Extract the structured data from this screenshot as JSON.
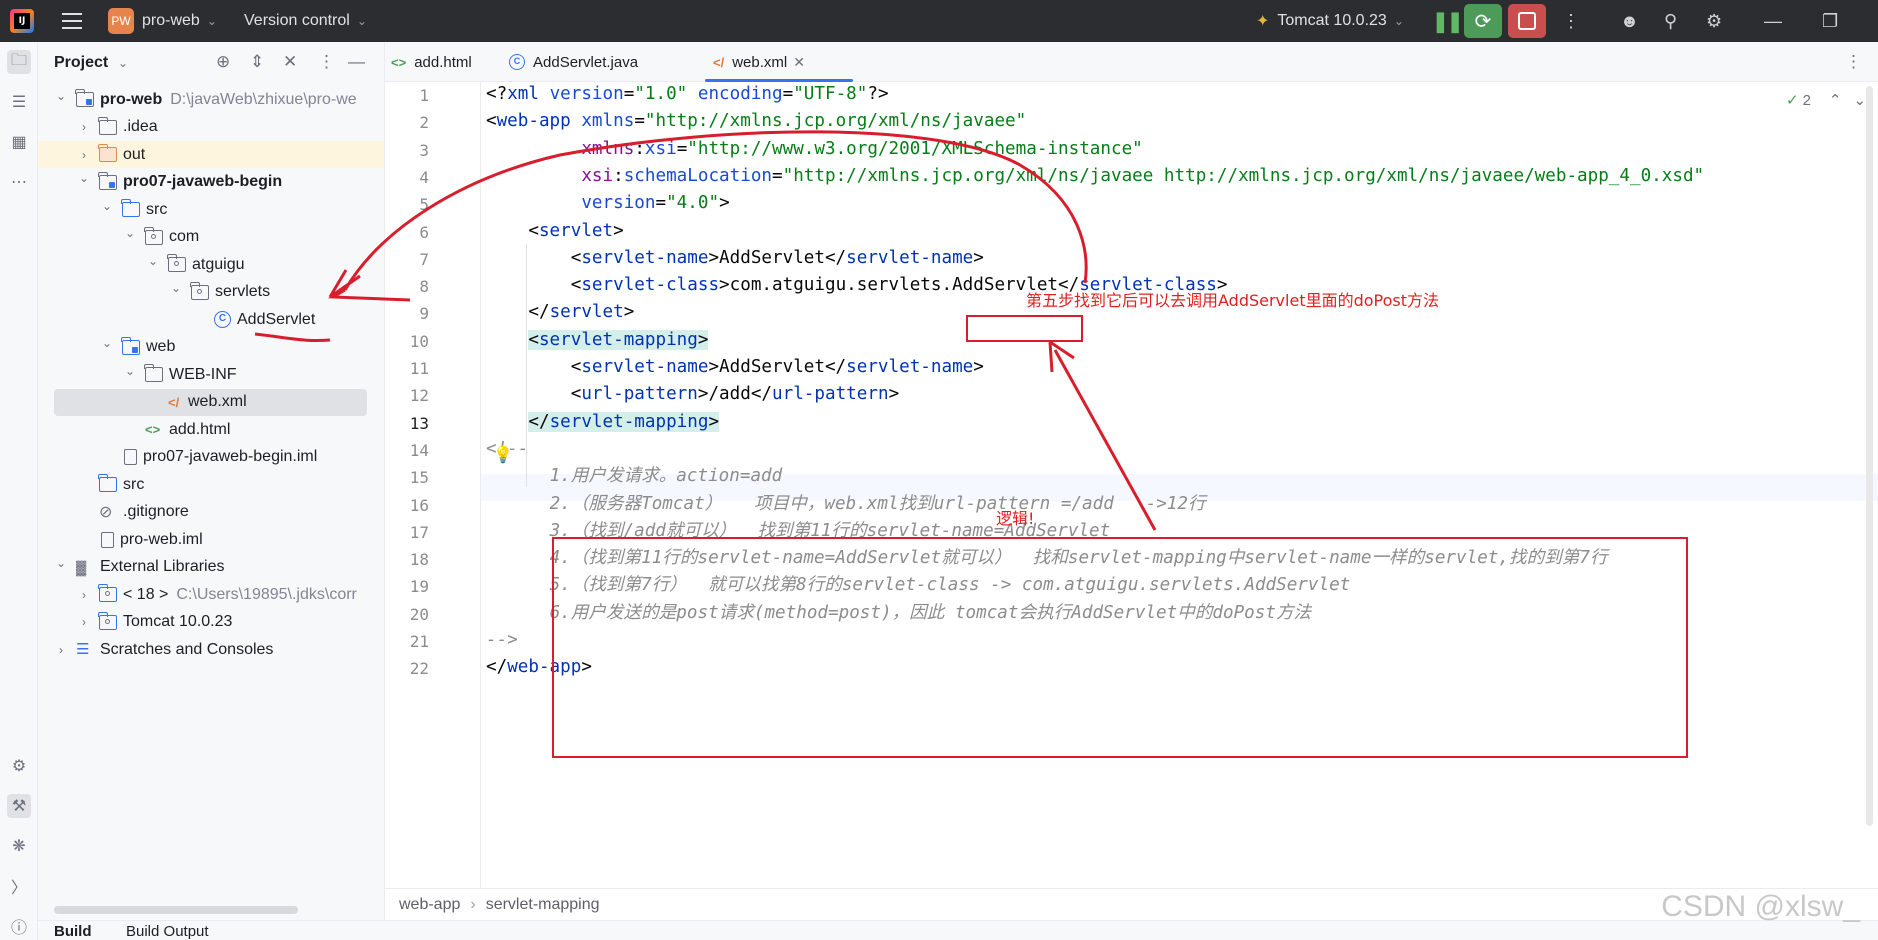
{
  "titlebar": {
    "project_badge": "PW",
    "project_name": "pro-web",
    "vcs": "Version control",
    "run_config": "Tomcat 10.0.23"
  },
  "project_panel": {
    "title": "Project",
    "tree": [
      {
        "label": "pro-web",
        "extra": "D:\\javaWeb\\zhixue\\pro-we",
        "depth": 0,
        "arrow": "open",
        "icon": "module-folder",
        "bold": true
      },
      {
        "label": ".idea",
        "depth": 1,
        "arrow": "closed",
        "icon": "folder"
      },
      {
        "label": "out",
        "depth": 1,
        "arrow": "closed",
        "icon": "folder-orange"
      },
      {
        "label": "pro07-javaweb-begin",
        "depth": 1,
        "arrow": "open",
        "icon": "module-folder",
        "bold": true
      },
      {
        "label": "src",
        "depth": 2,
        "arrow": "open",
        "icon": "folder-blue"
      },
      {
        "label": "com",
        "depth": 3,
        "arrow": "open",
        "icon": "package"
      },
      {
        "label": "atguigu",
        "depth": 4,
        "arrow": "open",
        "icon": "package"
      },
      {
        "label": "servlets",
        "depth": 5,
        "arrow": "open",
        "icon": "package"
      },
      {
        "label": "AddServlet",
        "depth": 6,
        "arrow": "none",
        "icon": "class"
      },
      {
        "label": "web",
        "depth": 2,
        "arrow": "open",
        "icon": "folder-web"
      },
      {
        "label": "WEB-INF",
        "depth": 3,
        "arrow": "open",
        "icon": "folder"
      },
      {
        "label": "web.xml",
        "depth": 4,
        "arrow": "none",
        "icon": "xml"
      },
      {
        "label": "add.html",
        "depth": 3,
        "arrow": "none",
        "icon": "html"
      },
      {
        "label": "pro07-javaweb-begin.iml",
        "depth": 2,
        "arrow": "none",
        "icon": "file"
      },
      {
        "label": "src",
        "depth": 1,
        "arrow": "none",
        "icon": "folder-blue"
      },
      {
        "label": ".gitignore",
        "depth": 1,
        "arrow": "none",
        "icon": "ignore"
      },
      {
        "label": "pro-web.iml",
        "depth": 1,
        "arrow": "none",
        "icon": "file"
      },
      {
        "label": "External Libraries",
        "depth": 0,
        "arrow": "open",
        "icon": "library"
      },
      {
        "label": "< 18 >",
        "extra": "C:\\Users\\19895\\.jdks\\corr",
        "depth": 1,
        "arrow": "closed",
        "icon": "jdk"
      },
      {
        "label": "Tomcat 10.0.23",
        "depth": 1,
        "arrow": "closed",
        "icon": "library-folder"
      },
      {
        "label": "Scratches and Consoles",
        "depth": 0,
        "arrow": "closed",
        "icon": "scratches"
      }
    ]
  },
  "tabs": [
    {
      "label": "add.html",
      "icon": "html-icon"
    },
    {
      "label": "AddServlet.java",
      "icon": "class-icon"
    },
    {
      "label": "web.xml",
      "icon": "xml-icon",
      "active": true
    }
  ],
  "editor": {
    "inspection_count": "2",
    "line_numbers": [
      "1",
      "2",
      "3",
      "4",
      "5",
      "6",
      "7",
      "8",
      "9",
      "10",
      "11",
      "12",
      "13",
      "14",
      "15",
      "16",
      "17",
      "18",
      "19",
      "20",
      "21",
      "22"
    ],
    "current_line": "13",
    "comment_lines": [
      "1.用户发请求。action=add",
      "2.（服务器Tomcat）   项目中，web.xml找到url-pattern =/add   ->12行",
      "3.（找到/add就可以）  找到第11行的servlet-name=AddServlet",
      "4.（找到第11行的servlet-name=AddServlet就可以）  找和servlet-mapping中servlet-name一样的servlet,找的到第7行",
      "5.（找到第7行）  就可以找第8行的servlet-class -> com.atguigu.servlets.AddServlet",
      "6.用户发送的是post请求(method=post)，因此 tomcat会执行AddServlet中的doPost方法"
    ]
  },
  "annotations": {
    "step5": "第五步找到它后可以去调用AddServlet里面的doPost方法",
    "logic": "逻辑!"
  },
  "breadcrumb": [
    "web-app",
    "servlet-mapping"
  ],
  "bottom_tabs": [
    "Build",
    "Build Output"
  ],
  "watermark": "CSDN @xlsw_"
}
